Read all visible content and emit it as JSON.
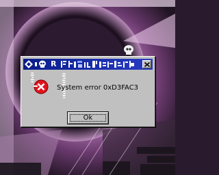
{
  "window": {
    "title": "R",
    "title_icons": [
      "diamond-icon",
      "skull-icon",
      "glitch-glyphs-icon"
    ],
    "close_icon": "close-icon"
  },
  "dialog": {
    "icon": "error-icon",
    "message": "System error 0xD3FAC3",
    "ok_label": "Ok"
  },
  "colors": {
    "titlebar": "#0a1c8a",
    "dialog_bg": "#c0c0c0",
    "error_red": "#e0141e"
  }
}
